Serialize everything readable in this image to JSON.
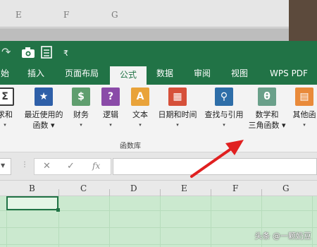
{
  "background_columns": [
    "E",
    "F",
    "G"
  ],
  "quick_access": {
    "icons": [
      "redo-icon",
      "camera-icon",
      "print-preview-icon",
      "customize-icon"
    ],
    "customize_glyph": "₹"
  },
  "tabs": [
    {
      "label": "始",
      "active": false
    },
    {
      "label": "插入",
      "active": false
    },
    {
      "label": "页面布局",
      "active": false
    },
    {
      "label": "公式",
      "active": true
    },
    {
      "label": "数据",
      "active": false
    },
    {
      "label": "审阅",
      "active": false
    },
    {
      "label": "视图",
      "active": false
    },
    {
      "label": "WPS PDF",
      "active": false
    }
  ],
  "ribbon": {
    "buttons": [
      {
        "line1": "求和",
        "line2": "▾",
        "icon": "autosum-icon",
        "glyph": "Σ"
      },
      {
        "line1": "最近使用的",
        "line2": "函数 ▾",
        "icon": "recent-star-icon",
        "glyph": "★"
      },
      {
        "line1": "财务",
        "line2": "▾",
        "icon": "finance-coins-icon",
        "glyph": "$"
      },
      {
        "line1": "逻辑",
        "line2": "▾",
        "icon": "logic-question-icon",
        "glyph": "?"
      },
      {
        "line1": "文本",
        "line2": "▾",
        "icon": "text-a-icon",
        "glyph": "A"
      },
      {
        "line1": "日期和时间",
        "line2": "▾",
        "icon": "calendar-icon",
        "glyph": "▦"
      },
      {
        "line1": "查找与引用",
        "line2": "▾",
        "icon": "lookup-search-icon",
        "glyph": "⚲"
      },
      {
        "line1": "数学和",
        "line2": "三角函数 ▾",
        "icon": "math-theta-icon",
        "glyph": "θ"
      },
      {
        "line1": "其他函",
        "line2": "▾",
        "icon": "other-functions-icon",
        "glyph": "▤"
      }
    ],
    "group_label": "函数库"
  },
  "formula_bar": {
    "cancel": "✕",
    "enter": "✓",
    "fx": "fx",
    "value": ""
  },
  "columns": [
    "B",
    "C",
    "D",
    "E",
    "F",
    "G"
  ],
  "watermark": "头条 @一颗奶豆",
  "colors": {
    "ribbon_green": "#217346",
    "sheet_fill": "#cbe9cf",
    "arrow_red": "#e02020"
  }
}
